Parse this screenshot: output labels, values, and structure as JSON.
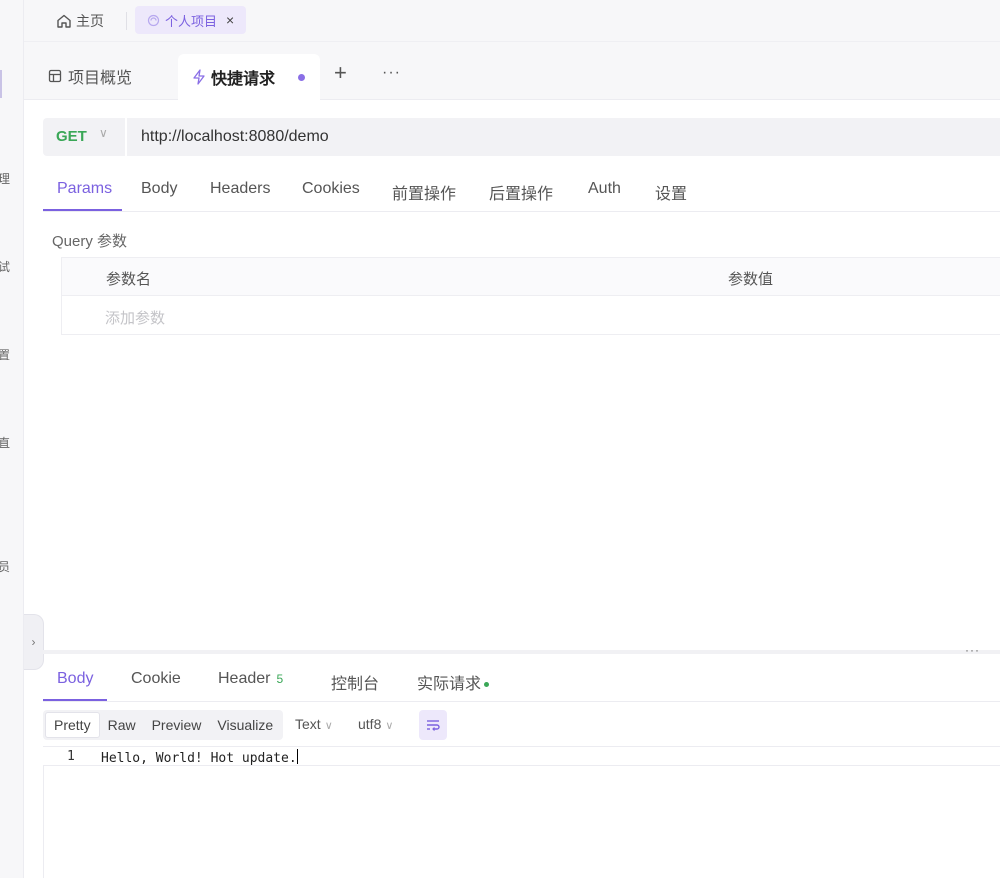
{
  "sidebar_fragments": [
    "理",
    "试",
    "置",
    "直",
    "员"
  ],
  "top_tabs": {
    "home_label": "主页",
    "project_label": "个人项目",
    "close_symbol": "×"
  },
  "sub_tabs": {
    "overview_label": "项目概览",
    "active_label": "快捷请求",
    "add_symbol": "+",
    "more_symbol": "···"
  },
  "request": {
    "method": "GET",
    "url": "http://localhost:8080/demo"
  },
  "request_tabs": [
    "Params",
    "Body",
    "Headers",
    "Cookies",
    "前置操作",
    "后置操作",
    "Auth",
    "设置"
  ],
  "query": {
    "title": "Query 参数",
    "col_name": "参数名",
    "col_value": "参数值",
    "add_placeholder": "添加参数"
  },
  "splitter_dots": "···",
  "response_tabs": {
    "body": "Body",
    "cookie": "Cookie",
    "header": "Header",
    "header_count": "5",
    "console": "控制台",
    "actual_request": "实际请求"
  },
  "response_toolbar": {
    "formats": [
      "Pretty",
      "Raw",
      "Preview",
      "Visualize"
    ],
    "type": "Text",
    "encoding": "utf8"
  },
  "response_body": {
    "line_number": "1",
    "content": "Hello, World! Hot update."
  },
  "colors": {
    "accent": "#7b61e0",
    "method_green": "#3aa757",
    "tab_bg": "#ede8fb"
  },
  "collapse_symbol": "›"
}
